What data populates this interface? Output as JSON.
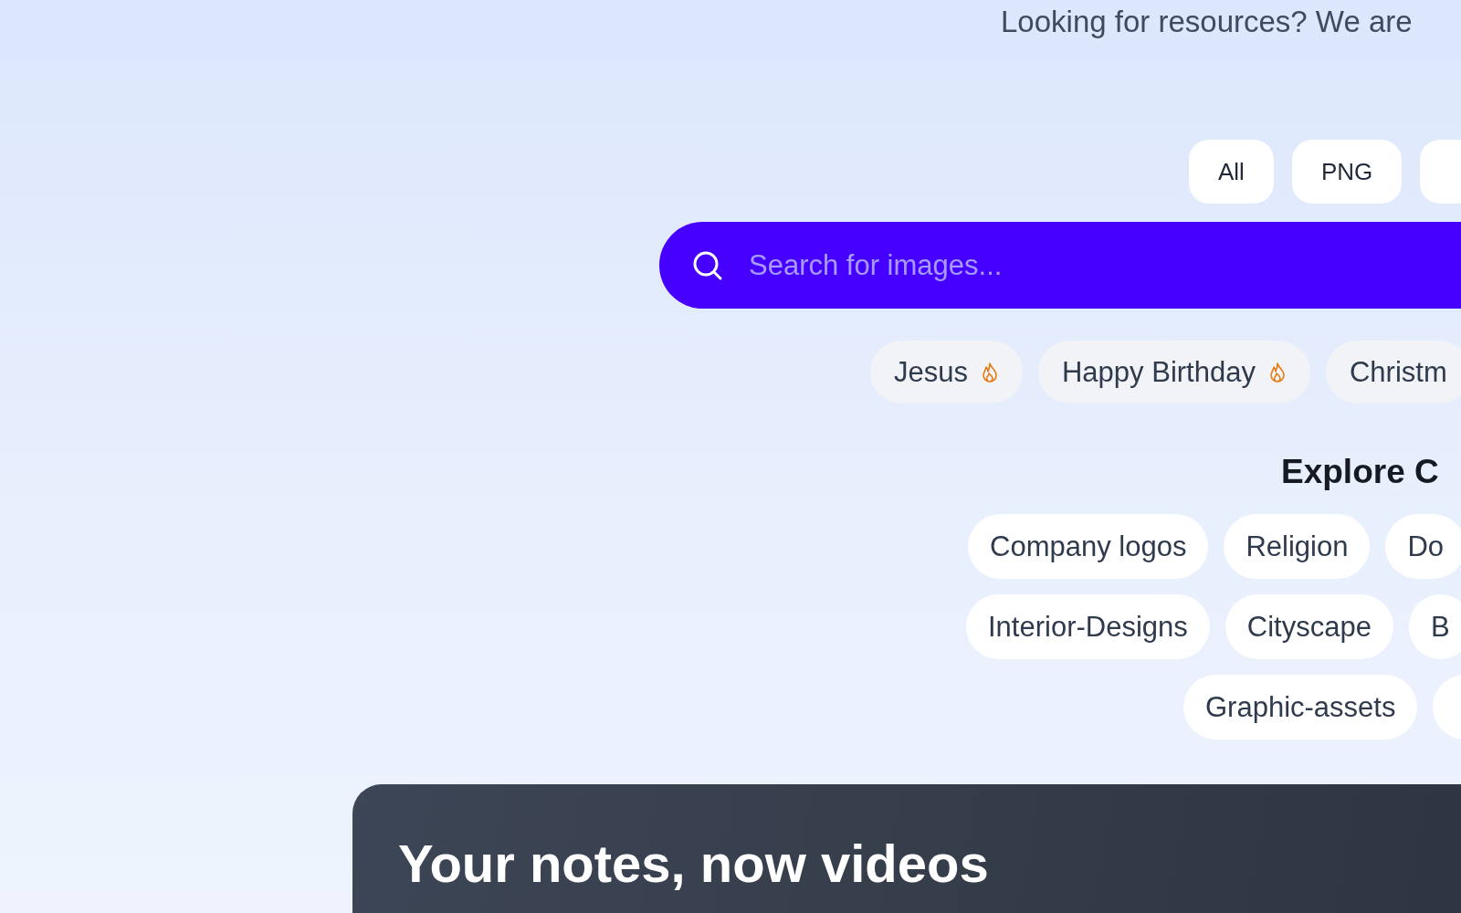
{
  "subtitle": "Looking for resources? We are",
  "filters": {
    "items": [
      {
        "label": "All"
      },
      {
        "label": "PNG"
      }
    ],
    "more": true
  },
  "search": {
    "placeholder": "Search for images..."
  },
  "trending": [
    {
      "label": "Jesus",
      "hot": true
    },
    {
      "label": "Happy Birthday",
      "hot": true
    },
    {
      "label": "Christm",
      "hot": false
    }
  ],
  "explore": {
    "title": "Explore C",
    "rows": [
      {
        "chips": [
          "Company logos",
          "Religion",
          "Do"
        ]
      },
      {
        "chips": [
          "Interior-Designs",
          "Cityscape",
          "B"
        ]
      },
      {
        "chips": [
          "Graphic-assets"
        ],
        "more": true
      }
    ]
  },
  "promo": {
    "title": "Your notes, now videos"
  }
}
